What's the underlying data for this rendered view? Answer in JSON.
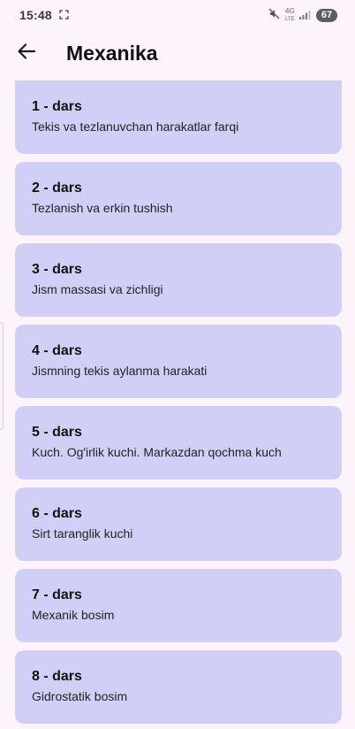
{
  "status_bar": {
    "time": "15:48",
    "network_top": "4G",
    "network_bottom": "LTE",
    "battery": "67"
  },
  "header": {
    "title": "Mexanika"
  },
  "lessons": [
    {
      "number": "1 - dars",
      "topic": "Tekis va tezlanuvchan harakatlar farqi"
    },
    {
      "number": "2 - dars",
      "topic": "Tezlanish va erkin tushish"
    },
    {
      "number": "3 - dars",
      "topic": "Jism massasi va zichligi"
    },
    {
      "number": "4 - dars",
      "topic": "Jismning tekis aylanma harakati"
    },
    {
      "number": "5 - dars",
      "topic": "Kuch. Og'irlik kuchi. Markazdan qochma kuch"
    },
    {
      "number": "6 - dars",
      "topic": "Sirt taranglik kuchi"
    },
    {
      "number": "7 - dars",
      "topic": "Mexanik bosim"
    },
    {
      "number": "8 - dars",
      "topic": "Gidrostatik bosim"
    }
  ],
  "colors": {
    "background": "#fdf3fa",
    "card": "#d0d0f7"
  }
}
